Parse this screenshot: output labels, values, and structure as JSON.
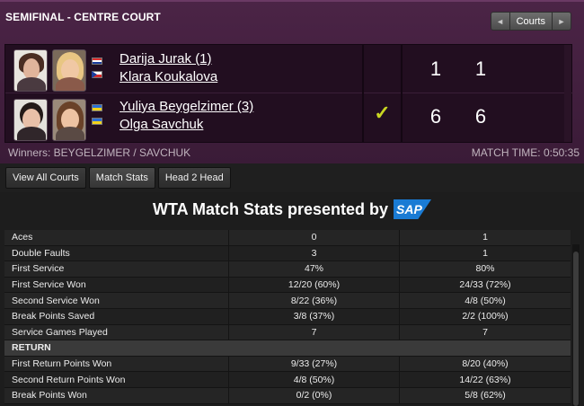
{
  "header": {
    "title": "SEMIFINAL - CENTRE COURT",
    "courts_label": "Courts",
    "prev_arrow": "◄",
    "next_arrow": "►"
  },
  "teams": [
    {
      "player1": "Darija Jurak (1)",
      "player2": "Klara Koukalova",
      "flags": [
        "croatia-flag",
        "czech-flag"
      ],
      "sets": [
        "1",
        "1"
      ],
      "winner": false
    },
    {
      "player1": "Yuliya Beygelzimer (3)",
      "player2": "Olga Savchuk",
      "flags": [
        "ukraine-flag",
        "ukraine-flag"
      ],
      "sets": [
        "6",
        "6"
      ],
      "winner": true,
      "check": "✓"
    }
  ],
  "footer": {
    "winners": "Winners: BEYGELZIMER / SAVCHUK",
    "match_time": "MATCH TIME: 0:50:35"
  },
  "tabs": [
    "View All Courts",
    "Match Stats",
    "Head 2 Head"
  ],
  "stats": {
    "title": "WTA Match Stats presented by",
    "sponsor": "SAP",
    "rows": [
      {
        "label": "Aces",
        "t1": "0",
        "t2": "1"
      },
      {
        "label": "Double Faults",
        "t1": "3",
        "t2": "1"
      },
      {
        "label": "First Service",
        "t1": "47%",
        "t2": "80%"
      },
      {
        "label": "First Service Won",
        "t1": "12/20 (60%)",
        "t2": "24/33 (72%)"
      },
      {
        "label": "Second Service Won",
        "t1": "8/22 (36%)",
        "t2": "4/8 (50%)"
      },
      {
        "label": "Break Points Saved",
        "t1": "3/8 (37%)",
        "t2": "2/2 (100%)"
      },
      {
        "label": "Service Games Played",
        "t1": "7",
        "t2": "7"
      }
    ],
    "section": "RETURN",
    "return_rows": [
      {
        "label": "First Return Points Won",
        "t1": "9/33 (27%)",
        "t2": "8/20 (40%)"
      },
      {
        "label": "Second Return Points Won",
        "t1": "4/8 (50%)",
        "t2": "14/22 (63%)"
      },
      {
        "label": "Break Points Won",
        "t1": "0/2 (0%)",
        "t2": "5/8 (62%)"
      }
    ]
  },
  "colors": {
    "panel": "#4b2446",
    "check": "#c9d622",
    "sap_blue": "#1a7bd4"
  }
}
